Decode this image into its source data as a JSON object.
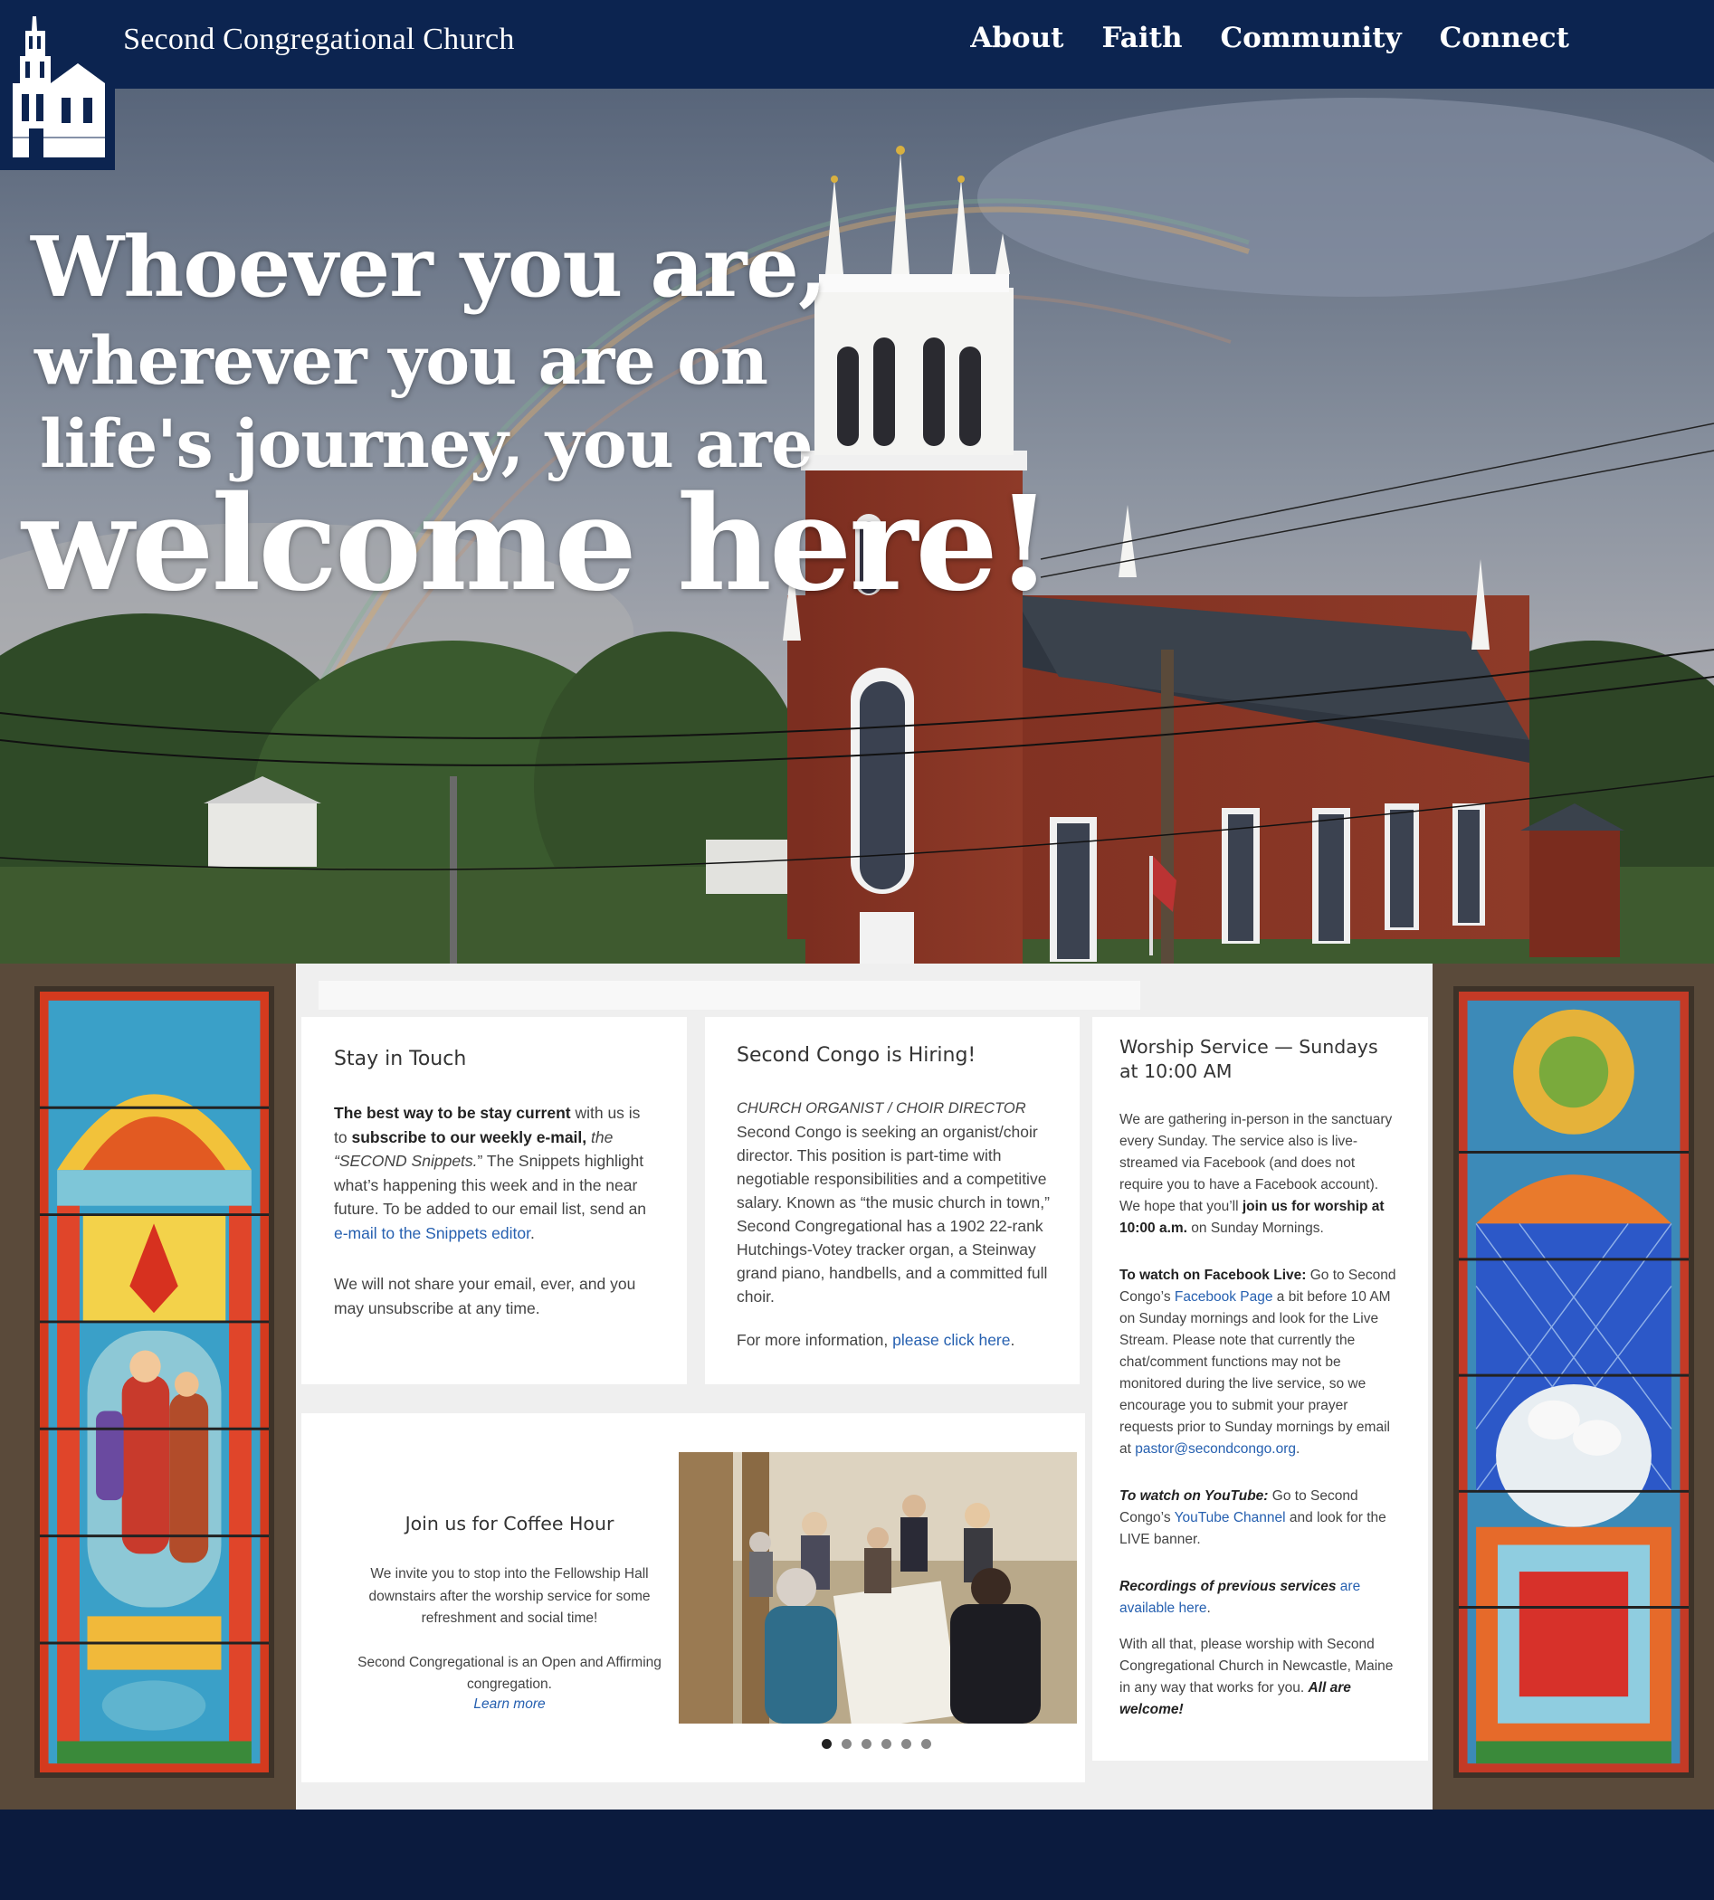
{
  "header": {
    "site_title": "The Second Congregational Church",
    "nav": [
      "About",
      "Faith",
      "Community",
      "Connect"
    ]
  },
  "hero": {
    "line1": "Whoever you are,",
    "line2": "wherever you are on",
    "line3": "life's journey, you are",
    "line4": "welcome here!"
  },
  "stay_in_touch": {
    "title": "Stay in Touch",
    "b1": "The best way to be stay current",
    "t1": " with us is to ",
    "b2": "subscribe to our weekly e-mail,",
    "i1": " the “SECOND Snippets.",
    "t2": "” The Snippets highlight what’s happening this week and in the near future. To be added to our email list, send an ",
    "link": "e-mail to the Snippets editor",
    "t3": ".",
    "p2": "We will not share your email, ever, and you may unsubscribe at any time."
  },
  "hiring": {
    "title": "Second Congo is Hiring!",
    "role": "CHURCH ORGANIST / CHOIR DIRECTOR",
    "body": "Second Congo is seeking an organist/choir director. This position is part-time with negotiable responsibilities and a competitive salary. Known as “the music church in town,” Second Congregational has a 1902 22-rank Hutchings-Votey tracker organ, a Steinway grand piano, handbells, and a committed full choir.",
    "more_prefix": "For more information, ",
    "more_link": "please click here",
    "more_suffix": "."
  },
  "worship": {
    "title": "Worship Service — Sundays at 10:00 AM",
    "p1a": "We are gathering in-person in the sanctuary every Sunday.  The service also is live-streamed via  Facebook (and does not require you to have a Facebook account).  We hope that you’ll ",
    "p1b": "join us for worship at 10:00 a.m.",
    "p1c": " on Sunday Mornings.",
    "fb_label": "To watch on Facebook Live:",
    "fb_a": " Go to Second Congo’s ",
    "fb_link": "Facebook Page",
    "fb_b": " a bit before 10 AM on Sunday mornings and look for the Live Stream. Please note that currently the chat/comment functions may not be monitored during the live service, so we encourage you to submit your prayer requests prior to Sunday mornings by email at ",
    "fb_email": "pastor@secondcongo.org",
    "fb_c": ".",
    "yt_label": "To watch on YouTube:",
    "yt_a": "  Go to Second Congo’s ",
    "yt_link": "YouTube Channel",
    "yt_b": " and look for the LIVE banner.",
    "rec_label": "Recordings of previous services",
    "rec_link": " are available here",
    "rec_c": ".",
    "closing_a": "With all that, please worship with Second Congregational Church in Newcastle, Maine in any way that works for you. ",
    "closing_b": "All are welcome!"
  },
  "coffee": {
    "title": "Join us for Coffee Hour",
    "p1": "We invite you to stop into the Fellowship Hall downstairs after the worship service for some refreshment and social time!",
    "p2": "Second Congregational is an Open and Affirming congregation.",
    "learn": "Learn more",
    "slides": 6,
    "active_slide": 1
  },
  "colors": {
    "header_bg": "#0c2450",
    "footer_bg": "#0b1b3e",
    "band_bg": "#5a4a3a",
    "link": "#2660b0"
  },
  "icons": [
    "church-logo-icon"
  ]
}
